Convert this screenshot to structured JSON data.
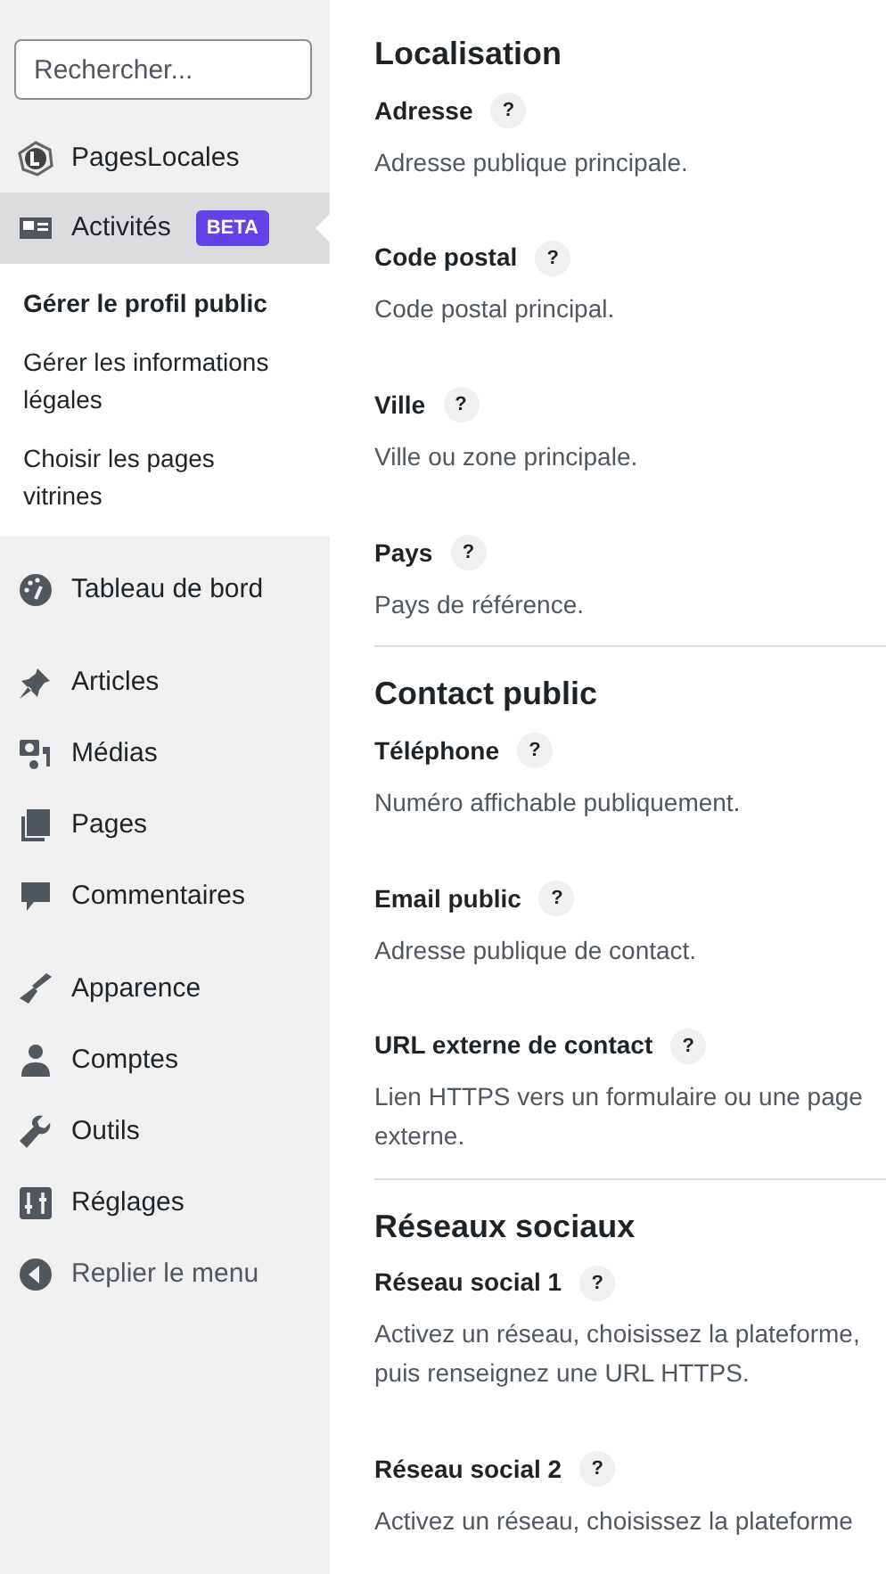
{
  "sidebar": {
    "search": {
      "placeholder": "Rechercher..."
    },
    "groups": [
      {
        "items": [
          {
            "kind": "brand",
            "label": "PagesLocales",
            "selected": false
          },
          {
            "kind": "item",
            "label": "Activités",
            "badge": "BETA",
            "selected": true,
            "submenu": [
              {
                "label": "Gérer le profil public",
                "selected": true
              },
              {
                "label": "Gérer les informations légales",
                "selected": false
              },
              {
                "label": "Choisir les pages vitrines",
                "selected": false
              }
            ]
          }
        ]
      },
      {
        "items": [
          {
            "kind": "item",
            "label": "Tableau de bord",
            "selected": false
          }
        ]
      },
      {
        "items": [
          {
            "kind": "item",
            "label": "Articles",
            "selected": false
          },
          {
            "kind": "item",
            "label": "Médias",
            "selected": false
          },
          {
            "kind": "item",
            "label": "Pages",
            "selected": false
          },
          {
            "kind": "item",
            "label": "Commentaires",
            "selected": false
          }
        ]
      },
      {
        "items": [
          {
            "kind": "item",
            "label": "Apparence",
            "selected": false
          },
          {
            "kind": "item",
            "label": "Comptes",
            "selected": false
          },
          {
            "kind": "item",
            "label": "Outils",
            "selected": false
          },
          {
            "kind": "item",
            "label": "Réglages",
            "selected": false
          },
          {
            "kind": "collapse",
            "label": "Replier le menu",
            "selected": false
          }
        ]
      }
    ]
  },
  "sections": [
    {
      "title": "Localisation",
      "fields": [
        {
          "label": "Adresse",
          "help": "?",
          "description": "Adresse publique principale."
        },
        {
          "label": "Code postal",
          "help": "?",
          "description": "Code postal principal."
        },
        {
          "label": "Ville",
          "help": "?",
          "description": "Ville ou zone principale."
        },
        {
          "label": "Pays",
          "help": "?",
          "description": "Pays de référence."
        }
      ]
    },
    {
      "title": "Contact public",
      "fields": [
        {
          "label": "Téléphone",
          "help": "?",
          "description": "Numéro affichable publiquement."
        },
        {
          "label": "Email public",
          "help": "?",
          "description": "Adresse publique de contact."
        },
        {
          "label": "URL externe de contact",
          "help": "?",
          "description": "Lien HTTPS vers un formulaire ou une page externe."
        }
      ]
    },
    {
      "title": "Réseaux sociaux",
      "fields": [
        {
          "label": "Réseau social 1",
          "help": "?",
          "description": "Activez un réseau, choisissez la plateforme, puis renseignez une URL HTTPS."
        },
        {
          "label": "Réseau social 2",
          "help": "?",
          "description": "Activez un réseau, choisissez la plateforme"
        }
      ]
    }
  ]
}
